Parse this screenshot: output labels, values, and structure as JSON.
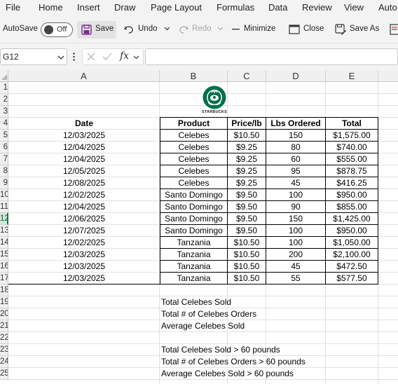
{
  "menu": [
    "File",
    "Home",
    "Insert",
    "Draw",
    "Page Layout",
    "Formulas",
    "Data",
    "Review",
    "View",
    "Auto"
  ],
  "toolbar": {
    "autosave_label": "AutoSave",
    "autosave_state": "Off",
    "save": "Save",
    "undo": "Undo",
    "redo": "Redo",
    "minimize": "Minimize",
    "close": "Close",
    "save_as": "Save As"
  },
  "formula_bar": {
    "name_box": "G12",
    "fx": "fx",
    "formula": ""
  },
  "columns": [
    "A",
    "B",
    "C",
    "D",
    "E"
  ],
  "rows": [
    "1",
    "2",
    "3",
    "4",
    "5",
    "6",
    "7",
    "8",
    "9",
    "10",
    "11",
    "12",
    "13",
    "14",
    "15",
    "16",
    "17",
    "18",
    "19",
    "20",
    "21",
    "22",
    "23",
    "24",
    "25"
  ],
  "logo": {
    "text": "STARBUCKS",
    "color": "#00704a"
  },
  "table": {
    "headers": [
      "Date",
      "Product",
      "Price/lb",
      "Lbs Ordered",
      "Total"
    ],
    "rows": [
      [
        "12/03/2025",
        "Celebes",
        "$10.50",
        "150",
        "$1,575.00"
      ],
      [
        "12/04/2025",
        "Celebes",
        "$9.25",
        "80",
        "$740.00"
      ],
      [
        "12/04/2025",
        "Celebes",
        "$9.25",
        "60",
        "$555.00"
      ],
      [
        "12/05/2025",
        "Celebes",
        "$9.25",
        "95",
        "$878.75"
      ],
      [
        "12/08/2025",
        "Celebes",
        "$9.25",
        "45",
        "$416.25"
      ],
      [
        "12/02/2025",
        "Santo Domingo",
        "$9.50",
        "100",
        "$950.00"
      ],
      [
        "12/04/2025",
        "Santo Domingo",
        "$9.50",
        "90",
        "$855.00"
      ],
      [
        "12/06/2025",
        "Santo Domingo",
        "$9.50",
        "150",
        "$1,425.00"
      ],
      [
        "12/07/2025",
        "Santo Domingo",
        "$9.50",
        "100",
        "$950.00"
      ],
      [
        "12/02/2025",
        "Tanzania",
        "$10.50",
        "100",
        "$1,050.00"
      ],
      [
        "12/03/2025",
        "Tanzania",
        "$10.50",
        "200",
        "$2,100.00"
      ],
      [
        "12/03/2025",
        "Tanzania",
        "$10.50",
        "45",
        "$472.50"
      ],
      [
        "12/03/2025",
        "Tanzania",
        "$10.50",
        "55",
        "$577.50"
      ]
    ]
  },
  "labels": [
    "Total Celebes Sold",
    "Total # of Celebes Orders",
    "Average Celebes Sold",
    "Total Celebes Sold > 60 pounds",
    "Total # of Celebes Orders > 60 pounds",
    "Average Celebes Sold > 60 pounds"
  ],
  "active_row": "12"
}
